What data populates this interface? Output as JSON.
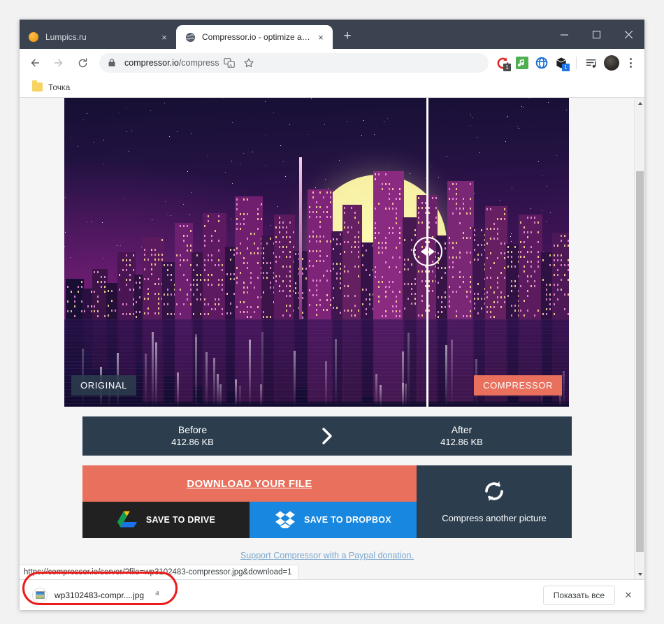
{
  "window": {
    "controls": {
      "minimize": "minimize-icon",
      "maximize": "maximize-icon",
      "close": "close-icon"
    }
  },
  "tabs": [
    {
      "title": "Lumpics.ru",
      "favicon": "orange-circle-favicon",
      "active": false,
      "close": "×"
    },
    {
      "title": "Compressor.io - optimize and co",
      "favicon": "globe-favicon",
      "active": true,
      "close": "×"
    }
  ],
  "new_tab_label": "+",
  "toolbar": {
    "back": "back-arrow-icon",
    "forward": "forward-arrow-icon",
    "reload": "reload-icon",
    "lock": "lock-icon",
    "url_host": "compressor.io",
    "url_path": "/compress",
    "translate": "translate-icon",
    "bookmark": "star-icon",
    "extensions": [
      {
        "name": "red-refresh-extension",
        "badge": "1",
        "badge_color": "#4c4c4c",
        "color": "#e02020"
      },
      {
        "name": "green-music-extension",
        "badge": "",
        "badge_color": "",
        "color": "#4caf50"
      },
      {
        "name": "blue-globe-extension",
        "badge": "",
        "badge_color": "",
        "color": "#1a6fd4"
      },
      {
        "name": "black-box-extension",
        "badge": "1",
        "badge_color": "#1a73e8",
        "color": "#1f1f1f"
      }
    ],
    "reading_list": "reading-list-icon",
    "profile": "profile-avatar",
    "menu": "kebab-menu-icon"
  },
  "bookmarks": [
    {
      "label": "Точка",
      "icon": "folder-icon"
    }
  ],
  "compare": {
    "original_label": "ORIGINAL",
    "compressor_label": "COMPRESSOR",
    "handle_icon": "slider-handle-icon"
  },
  "stats": {
    "before_title": "Before",
    "before_value": "412.86 KB",
    "arrow": "›",
    "after_title": "After",
    "after_value": "412.86 KB"
  },
  "actions": {
    "download_label": "DOWNLOAD YOUR FILE",
    "drive_label": "SAVE TO DRIVE",
    "dropbox_label": "SAVE TO DROPBOX",
    "compress_again_label": "Compress another picture",
    "refresh_icon": "refresh-icon"
  },
  "donate_text": "Support Compressor with a Paypal donation.",
  "status_url": "https://compressor.io/server/?file=wp3102483-compressor.jpg&download=1",
  "downloads": {
    "file_name": "wp3102483-compr....jpg",
    "caret": "ⱏ",
    "show_all_label": "Показать все",
    "close": "✕"
  },
  "colors": {
    "accent_coral": "#e8705c",
    "panel_dark": "#2c3e4e",
    "chrome_frame": "#3b4351",
    "dropbox_blue": "#1787e0",
    "annotation_red": "#ee1b1b"
  }
}
